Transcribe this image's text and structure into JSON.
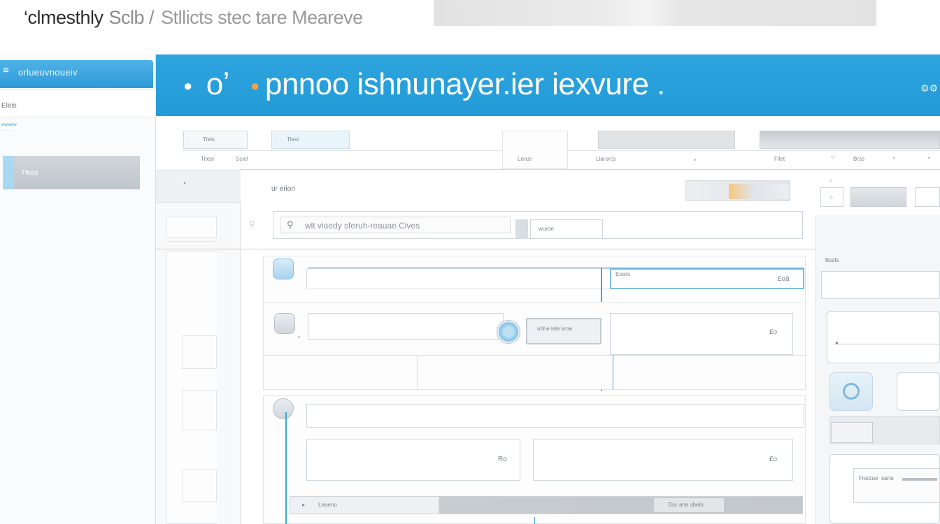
{
  "caption": {
    "part1": "‘clmesthly",
    "part2": "Sclb /",
    "part3": "Stllicts stec  tare Meareve"
  },
  "sidebar": {
    "header_icon": "≡",
    "header_title": "orlueuvnoueiv",
    "items": [
      {
        "label": "Eleis"
      },
      {
        "label": "Tleas"
      }
    ],
    "small_1": "wwwww",
    "small_2": "·······"
  },
  "header": {
    "title_mark": "oʼ",
    "title": "pnnoo ishnunayer.ier iexvure .",
    "settings_icon": "⚙⚙"
  },
  "toolbar": {
    "tab1": "Tleis",
    "tab2": "Tlest",
    "tab3": "Titesr",
    "tab4": "Sciel",
    "item5": "Lerus",
    "item6": "Llarorcs",
    "item7": "Fllet",
    "item8": "Brss"
  },
  "content": {
    "section_label": "ur erion",
    "search_placeholder": "wlt  viaedy sferuh-reauae Cives",
    "filter_label": "wuroe",
    "side_label": "Bssfs",
    "row1_right_label": "Eoars",
    "row1_value": "£oä",
    "row2_value": "£o",
    "row2_button": "ohhe lale kroe",
    "row3_value_left": "Ro",
    "row3_value_right": "£o",
    "footer_left": "Leaeno",
    "footer_right": "Dsc ane shelo",
    "panel_row_label": "Frarzue  sarte"
  },
  "icons": [
    "menu-icon",
    "settings-icon",
    "search-icon",
    "gear-icon",
    "chevron-down-icon",
    "arrow-right-icon",
    "user-icon",
    "refresh-icon"
  ],
  "colors": {
    "accent": "#229bd8",
    "sidebar_header": "#2f9bd8",
    "orange_guide": "#f2c39a"
  }
}
